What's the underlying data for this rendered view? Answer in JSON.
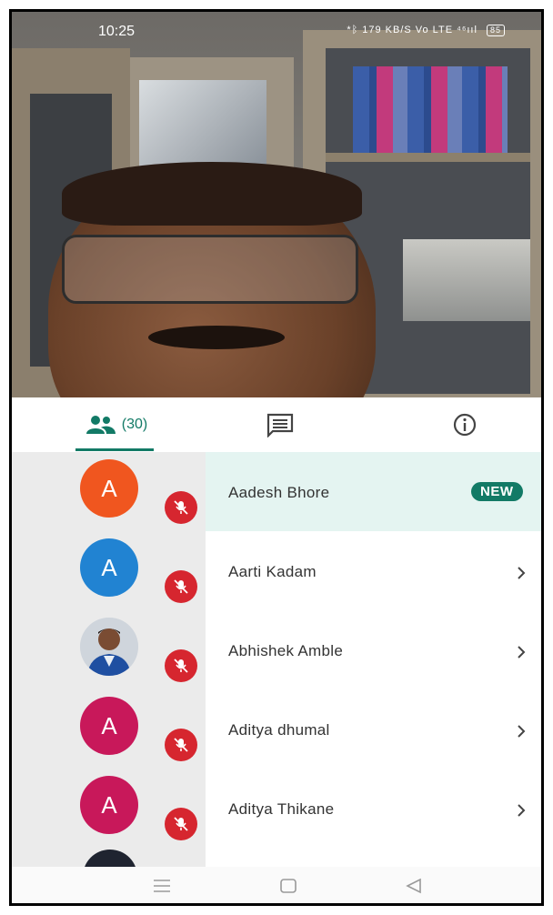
{
  "status_bar": {
    "time": "10:25",
    "network_text": "*ᛒ 179 KB/S Vo LTE ⁴⁶ııl",
    "battery": "85"
  },
  "tabs": {
    "people_count": "(30)"
  },
  "participants": [
    {
      "initial": "A",
      "name": "Aadesh Bhore",
      "badge": "NEW",
      "avatar_color": "#f0561f",
      "avatar_type": "letter"
    },
    {
      "initial": "A",
      "name": "Aarti Kadam",
      "avatar_color": "#2183d2",
      "avatar_type": "letter"
    },
    {
      "initial": "",
      "name": "Abhishek Amble",
      "avatar_type": "photo"
    },
    {
      "initial": "A",
      "name": "Aditya dhumal",
      "avatar_color": "#c8185a",
      "avatar_type": "letter"
    },
    {
      "initial": "A",
      "name": "Aditya Thikane",
      "avatar_color": "#c8185a",
      "avatar_type": "letter"
    }
  ],
  "colors": {
    "accent": "#127a66",
    "mute": "#d6262f",
    "highlight_row": "#e4f4f1"
  }
}
